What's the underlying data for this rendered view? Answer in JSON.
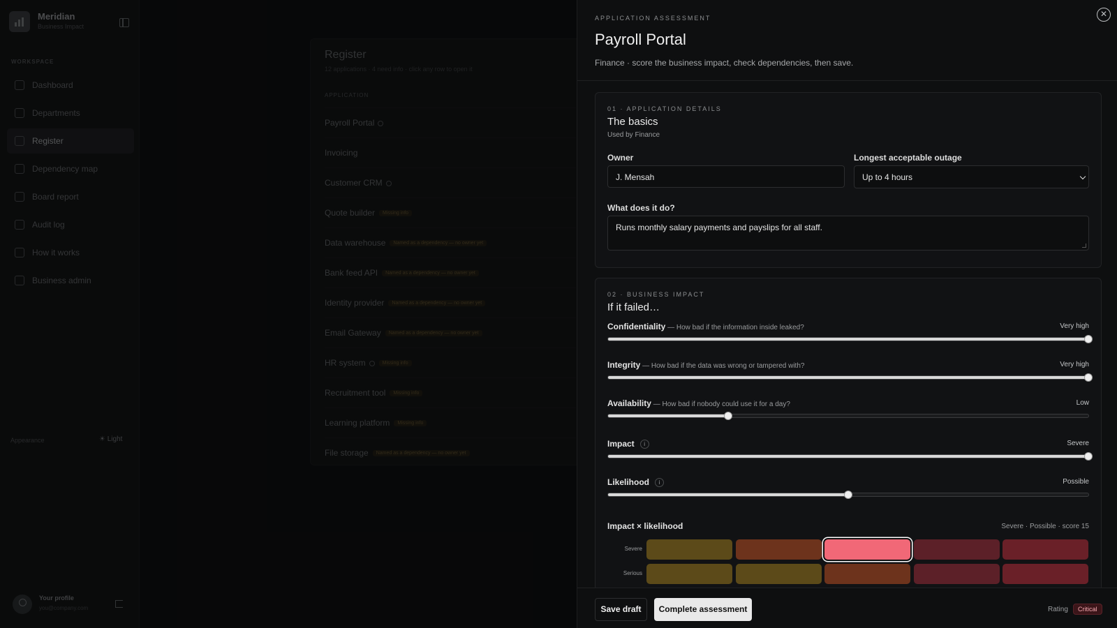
{
  "sidebar": {
    "brand_name": "Meridian",
    "brand_sub": "Business Impact",
    "section_label": "WORKSPACE",
    "items": [
      {
        "label": "Dashboard"
      },
      {
        "label": "Departments"
      },
      {
        "label": "Register",
        "active": true
      },
      {
        "label": "Dependency map"
      },
      {
        "label": "Board report"
      },
      {
        "label": "Audit log"
      },
      {
        "label": "How it works"
      },
      {
        "label": "Business admin"
      }
    ],
    "appearance_label": "Appearance",
    "theme_toggle": "☀ Light",
    "profile_name": "Your profile",
    "profile_email": "you@company.com"
  },
  "register": {
    "title": "Register",
    "subtitle": "12 applications · 4 need info · click any row to open it",
    "column_header": "APPLICATION",
    "rows": [
      {
        "name": "Payroll Portal",
        "dot": true,
        "tag": ""
      },
      {
        "name": "Invoicing",
        "dot": false,
        "tag": ""
      },
      {
        "name": "Customer CRM",
        "dot": true,
        "tag": ""
      },
      {
        "name": "Quote builder",
        "dot": false,
        "tag": "Missing info"
      },
      {
        "name": "Data warehouse",
        "dot": false,
        "tag": "Named as a dependency — no owner yet"
      },
      {
        "name": "Bank feed API",
        "dot": false,
        "tag": "Named as a dependency — no owner yet"
      },
      {
        "name": "Identity provider",
        "dot": false,
        "tag": "Named as a dependency — no owner yet"
      },
      {
        "name": "Email Gateway",
        "dot": false,
        "tag": "Named as a dependency — no owner yet"
      },
      {
        "name": "HR system",
        "dot": true,
        "tag": "Missing info"
      },
      {
        "name": "Recruitment tool",
        "dot": false,
        "tag": "Missing info"
      },
      {
        "name": "Learning platform",
        "dot": false,
        "tag": "Missing info"
      },
      {
        "name": "File storage",
        "dot": false,
        "tag": "Named as a dependency — no owner yet"
      }
    ]
  },
  "panel": {
    "eyebrow": "APPLICATION ASSESSMENT",
    "title": "Payroll Portal",
    "subtitle": "Finance · score the business impact, check dependencies, then save.",
    "close_glyph": "✕"
  },
  "details": {
    "eyebrow": "01 · APPLICATION DETAILS",
    "title": "The basics",
    "subtitle": "Used by Finance",
    "owner_label": "Owner",
    "owner_value": "J. Mensah",
    "outage_label": "Longest acceptable outage",
    "outage_value": "Up to 4 hours",
    "purpose_label": "What does it do?",
    "purpose_value": "Runs monthly salary payments and payslips for all staff."
  },
  "impact": {
    "eyebrow": "02 · BUSINESS IMPACT",
    "title": "If it failed…",
    "sliders": [
      {
        "name": "Confidentiality",
        "desc": " — How bad if the information inside leaked?",
        "value_label": "Very high",
        "level": 1.0,
        "info": false
      },
      {
        "name": "Integrity",
        "desc": " — How bad if the data was wrong or tampered with?",
        "value_label": "Very high",
        "level": 1.0,
        "info": false
      },
      {
        "name": "Availability",
        "desc": " — How bad if nobody could use it for a day?",
        "value_label": "Low",
        "level": 0.25,
        "info": false
      },
      {
        "name": "Impact",
        "desc": "",
        "value_label": "Severe",
        "level": 1.0,
        "info": true
      },
      {
        "name": "Likelihood",
        "desc": "",
        "value_label": "Possible",
        "level": 0.5,
        "info": true
      }
    ],
    "info_glyph": "i",
    "matrix_label": "Impact × likelihood",
    "matrix_score": "Severe · Possible · score 15",
    "matrix_rows": [
      {
        "label": "Severe",
        "colors": [
          "#5c4a19",
          "#6d331c",
          "#f16877",
          "#5c2028",
          "#6a2028"
        ],
        "selected": 2
      },
      {
        "label": "Serious",
        "colors": [
          "#5c4a19",
          "#5c4a19",
          "#6d331c",
          "#5c2028",
          "#6a2028"
        ],
        "selected": -1
      },
      {
        "label": "",
        "colors": [
          "#184a3e",
          "#5c4a19",
          "#6d331c",
          "#5c2028",
          "#6a2028"
        ],
        "selected": -1
      }
    ]
  },
  "footer": {
    "save_draft": "Save draft",
    "complete": "Complete assessment",
    "rating_label": "Rating",
    "rating_value": "Critical"
  }
}
